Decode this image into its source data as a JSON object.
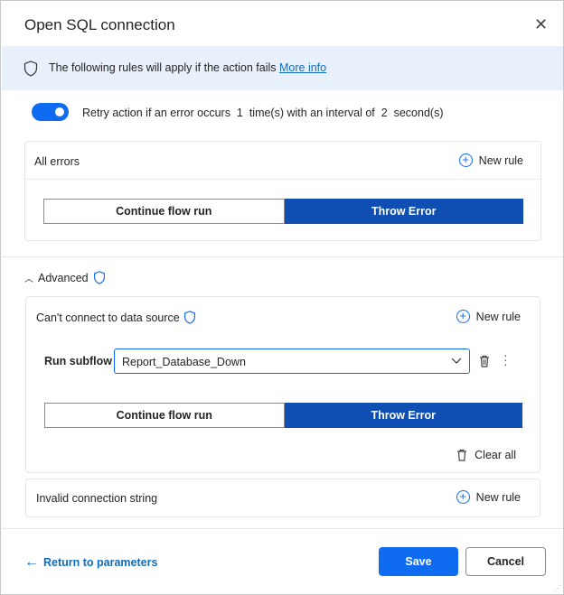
{
  "dialog": {
    "title": "Open SQL connection",
    "close_icon": "close-icon"
  },
  "banner": {
    "text": "The following rules will apply if the action fails",
    "link": "More info",
    "icon": "shield-icon"
  },
  "retry": {
    "enabled": true,
    "prefix": "Retry action if an error occurs",
    "times": "1",
    "middle": "time(s) with an interval of",
    "interval": "2",
    "suffix": "second(s)"
  },
  "all_errors": {
    "title": "All errors",
    "new_rule": "New rule",
    "options": [
      "Continue flow run",
      "Throw Error"
    ],
    "selected": "Throw Error"
  },
  "advanced": {
    "label": "Advanced",
    "expanded": true,
    "cant_connect": {
      "title": "Can't connect to data source",
      "new_rule": "New rule",
      "run_subflow_label": "Run subflow",
      "subflow_value": "Report_Database_Down",
      "options": [
        "Continue flow run",
        "Throw Error"
      ],
      "selected": "Throw Error",
      "clear_all": "Clear all"
    },
    "invalid_conn": {
      "title": "Invalid connection string",
      "new_rule": "New rule"
    }
  },
  "footer": {
    "return_link": "Return to parameters",
    "save": "Save",
    "cancel": "Cancel"
  },
  "colors": {
    "accent": "#0f6cf0",
    "selected_segment": "#0f4eb3",
    "banner": "#e8f0fc"
  }
}
